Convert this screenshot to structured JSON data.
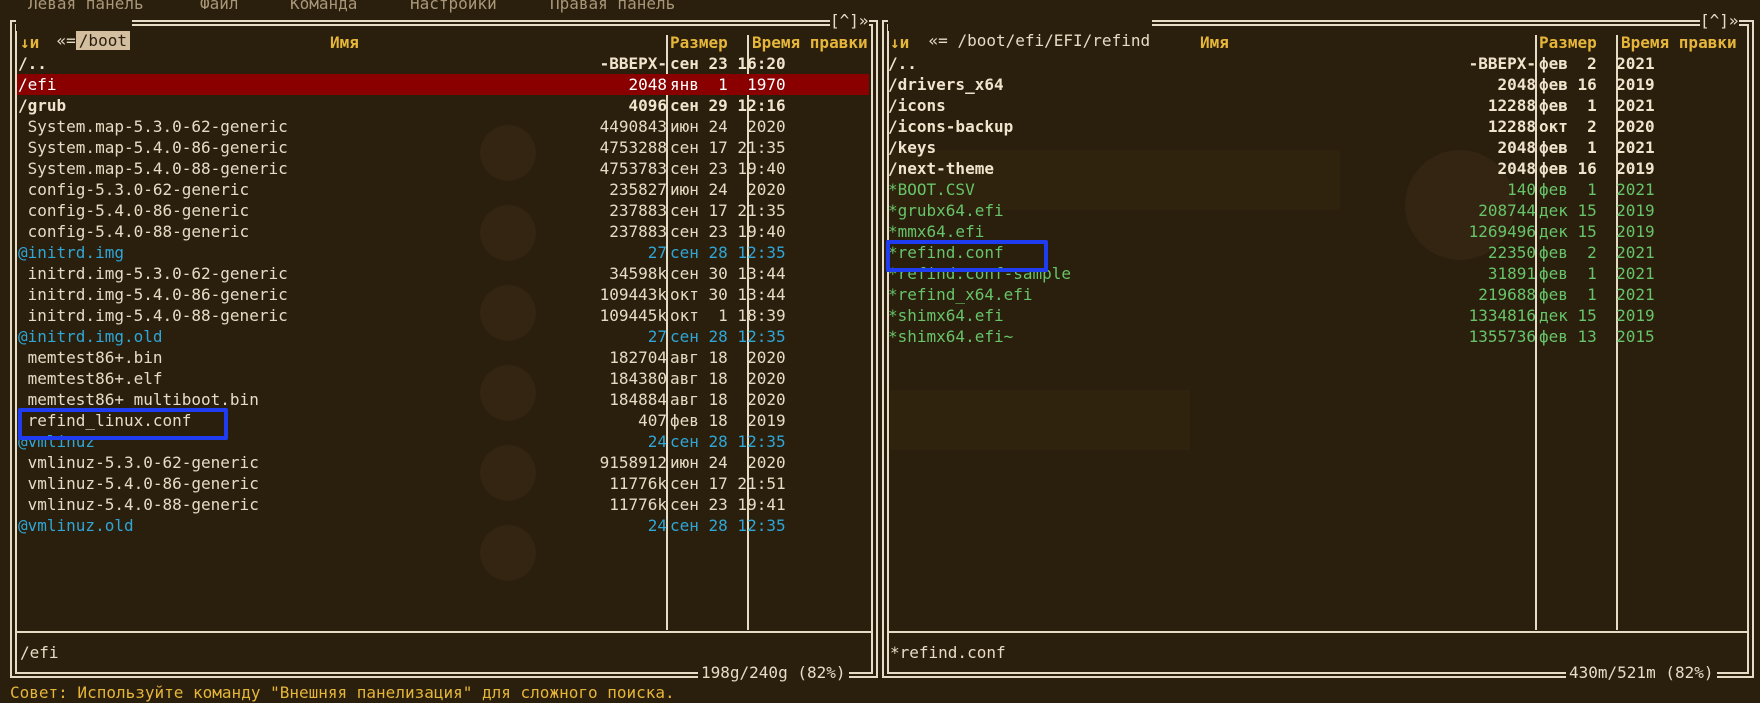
{
  "menu": [
    "Левая панель",
    "Файл",
    "Команда",
    "Настройки",
    "Правая панель"
  ],
  "left_panel": {
    "corner_left": "«=",
    "path": "/boot",
    "controls": "[^]»",
    "headers": {
      "sort": "↓и",
      "name": "Имя",
      "size": "Размер",
      "time": "Время правки"
    },
    "rows": [
      {
        "name": "/..",
        "size": "-ВВЕРХ-",
        "time": "сен 23 16:20",
        "type": "dir"
      },
      {
        "name": "/efi",
        "size": "2048",
        "time": "янв  1  1970",
        "type": "selected"
      },
      {
        "name": "/grub",
        "size": "4096",
        "time": "сен 29 12:16",
        "type": "dir"
      },
      {
        "name": " System.map-5.3.0-62-generic",
        "size": "4490843",
        "time": "июн 24  2020",
        "type": "file"
      },
      {
        "name": " System.map-5.4.0-86-generic",
        "size": "4753288",
        "time": "сен 17 21:35",
        "type": "file"
      },
      {
        "name": " System.map-5.4.0-88-generic",
        "size": "4753783",
        "time": "сен 23 19:40",
        "type": "file"
      },
      {
        "name": " config-5.3.0-62-generic",
        "size": "235827",
        "time": "июн 24  2020",
        "type": "file"
      },
      {
        "name": " config-5.4.0-86-generic",
        "size": "237883",
        "time": "сен 17 21:35",
        "type": "file"
      },
      {
        "name": " config-5.4.0-88-generic",
        "size": "237883",
        "time": "сен 23 19:40",
        "type": "file"
      },
      {
        "name": "@initrd.img",
        "size": "27",
        "time": "сен 28 12:35",
        "type": "link"
      },
      {
        "name": " initrd.img-5.3.0-62-generic",
        "size": "34598k",
        "time": "сен 30 13:44",
        "type": "file"
      },
      {
        "name": " initrd.img-5.4.0-86-generic",
        "size": "109443k",
        "time": "окт 30 13:44",
        "type": "file"
      },
      {
        "name": " initrd.img-5.4.0-88-generic",
        "size": "109445k",
        "time": "окт  1 18:39",
        "type": "file"
      },
      {
        "name": "@initrd.img.old",
        "size": "27",
        "time": "сен 28 12:35",
        "type": "link"
      },
      {
        "name": " memtest86+.bin",
        "size": "182704",
        "time": "авг 18  2020",
        "type": "file"
      },
      {
        "name": " memtest86+.elf",
        "size": "184380",
        "time": "авг 18  2020",
        "type": "file"
      },
      {
        "name": " memtest86+_multiboot.bin",
        "size": "184884",
        "time": "авг 18  2020",
        "type": "file"
      },
      {
        "name": " refind_linux.conf",
        "size": "407",
        "time": "фев 18  2019",
        "type": "file"
      },
      {
        "name": "@vmlinuz",
        "size": "24",
        "time": "сен 28 12:35",
        "type": "link"
      },
      {
        "name": " vmlinuz-5.3.0-62-generic",
        "size": "9158912",
        "time": "июн 24  2020",
        "type": "file"
      },
      {
        "name": " vmlinuz-5.4.0-86-generic",
        "size": "11776k",
        "time": "сен 17 21:51",
        "type": "file"
      },
      {
        "name": " vmlinuz-5.4.0-88-generic",
        "size": "11776k",
        "time": "сен 23 19:41",
        "type": "file"
      },
      {
        "name": "@vmlinuz.old",
        "size": "24",
        "time": "сен 28 12:35",
        "type": "link"
      }
    ],
    "mini_status": "/efi",
    "free": "198g/240g (82%)"
  },
  "right_panel": {
    "corner_left": "«=",
    "path": "/boot/efi/EFI/refind",
    "controls": "[^]»",
    "headers": {
      "sort": "↓и",
      "name": "Имя",
      "size": "Размер",
      "time": "Время правки"
    },
    "rows": [
      {
        "name": "/..",
        "size": "-ВВЕРХ-",
        "time": "фев  2  2021",
        "type": "dir"
      },
      {
        "name": "/drivers_x64",
        "size": "2048",
        "time": "фев 16  2019",
        "type": "dir"
      },
      {
        "name": "/icons",
        "size": "12288",
        "time": "фев  1  2021",
        "type": "dir"
      },
      {
        "name": "/icons-backup",
        "size": "12288",
        "time": "окт  2  2020",
        "type": "dir"
      },
      {
        "name": "/keys",
        "size": "2048",
        "time": "фев  1  2021",
        "type": "dir"
      },
      {
        "name": "/next-theme",
        "size": "2048",
        "time": "фев 16  2019",
        "type": "dir"
      },
      {
        "name": "*BOOT.CSV",
        "size": "140",
        "time": "фев  1  2021",
        "type": "exe"
      },
      {
        "name": "*grubx64.efi",
        "size": "208744",
        "time": "дек 15  2019",
        "type": "exe"
      },
      {
        "name": "*mmx64.efi",
        "size": "1269496",
        "time": "дек 15  2019",
        "type": "exe"
      },
      {
        "name": "*refind.conf",
        "size": "22350",
        "time": "фев  2  2021",
        "type": "exe"
      },
      {
        "name": "*refind.conf-sample",
        "size": "31891",
        "time": "фев  1  2021",
        "type": "exe"
      },
      {
        "name": "*refind_x64.efi",
        "size": "219688",
        "time": "фев  1  2021",
        "type": "exe"
      },
      {
        "name": "*shimx64.efi",
        "size": "1334816",
        "time": "дек 15  2019",
        "type": "exe"
      },
      {
        "name": "*shimx64.efi~",
        "size": "1355736",
        "time": "фев 13  2015",
        "type": "exe"
      }
    ],
    "mini_status": "*refind.conf",
    "free": "430m/521m (82%)"
  },
  "hint": "Совет: Используйте команду \"Внешняя панелизация\" для сложного поиска.",
  "colors": {
    "highlight_box": "#1f3cf0",
    "selection": "#8a0000",
    "header": "#e6b63a",
    "link": "#2fa6d6",
    "exe": "#67c46a"
  }
}
